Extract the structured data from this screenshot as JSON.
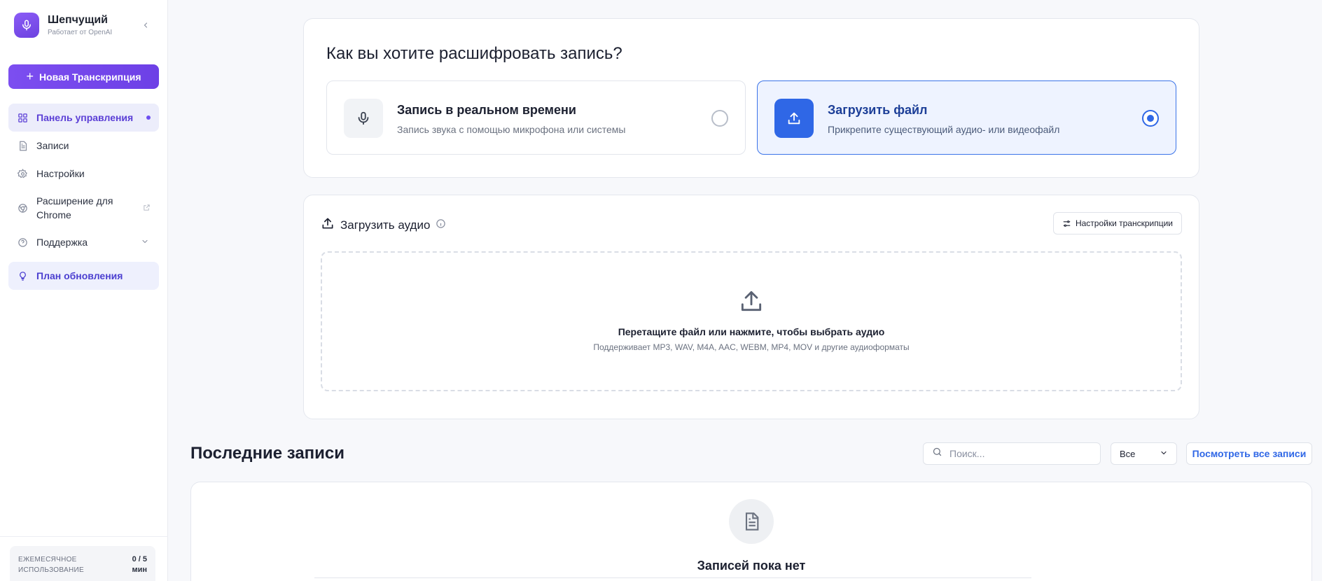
{
  "brand": {
    "name": "Шепчущий",
    "subtitle": "Работает от OpenAI"
  },
  "sidebar": {
    "new_button": "Новая Транскрипция",
    "items": [
      {
        "label": "Панель управления",
        "icon": "dashboard-icon",
        "active": true
      },
      {
        "label": "Записи",
        "icon": "document-icon"
      },
      {
        "label": "Настройки",
        "icon": "gear-icon"
      },
      {
        "label": "Расширение для Chrome",
        "icon": "chrome-icon"
      },
      {
        "label": "Поддержка",
        "icon": "help-icon"
      }
    ],
    "upgrade": "План обновления",
    "usage_label": "ЕЖЕМЕСЯЧНОЕ ИСПОЛЬЗОВАНИЕ",
    "usage_value": "0 / 5 мин"
  },
  "method": {
    "title": "Как вы хотите расшифровать запись?",
    "options": [
      {
        "title": "Запись в реальном времени",
        "desc": "Запись звука с помощью микрофона или системы",
        "selected": false
      },
      {
        "title": "Загрузить файл",
        "desc": "Прикрепите существующий аудио- или видеофайл",
        "selected": true
      }
    ]
  },
  "upload": {
    "title": "Загрузить аудио",
    "settings_button": "Настройки транскрипции",
    "drop_title": "Перетащите файл или нажмите, чтобы выбрать аудио",
    "drop_sub": "Поддерживает MP3, WAV, M4A, AAC, WEBM, MP4, MOV и другие аудиоформаты"
  },
  "recent": {
    "title": "Последние записи",
    "search_placeholder": "Поиск...",
    "filter_value": "Все",
    "view_all": "Посмотреть все записи",
    "empty_title": "Записей пока нет"
  },
  "colors": {
    "accent": "#6d40e6",
    "primary_blue": "#2f67e6"
  }
}
